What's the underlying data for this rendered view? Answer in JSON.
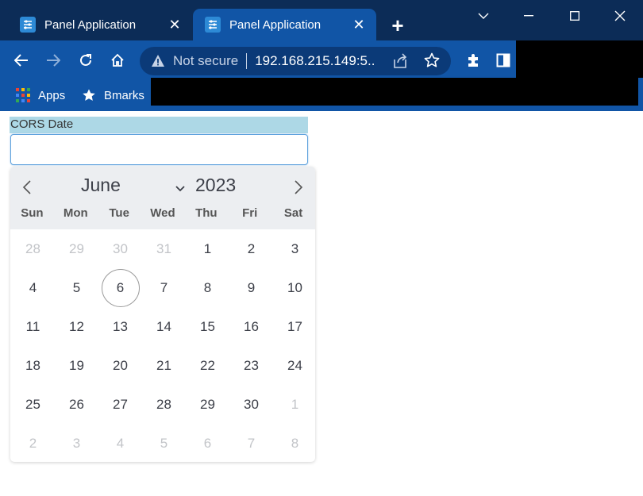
{
  "browser": {
    "tabs": [
      {
        "title": "Panel Application",
        "active": false
      },
      {
        "title": "Panel Application",
        "active": true
      }
    ],
    "omnibox": {
      "security_label": "Not secure",
      "url": "192.168.215.149:5..."
    },
    "bookmarks": [
      {
        "label": "Apps",
        "icon": "apps-grid-icon"
      },
      {
        "label": "Bmarks",
        "icon": "star-icon"
      }
    ]
  },
  "page": {
    "field_label": "CORS Date",
    "input_value": ""
  },
  "calendar": {
    "month": "June",
    "year": "2023",
    "weekdays": [
      "Sun",
      "Mon",
      "Tue",
      "Wed",
      "Thu",
      "Fri",
      "Sat"
    ],
    "weeks": [
      [
        {
          "d": "28",
          "o": true
        },
        {
          "d": "29",
          "o": true
        },
        {
          "d": "30",
          "o": true
        },
        {
          "d": "31",
          "o": true
        },
        {
          "d": "1"
        },
        {
          "d": "2"
        },
        {
          "d": "3"
        }
      ],
      [
        {
          "d": "4"
        },
        {
          "d": "5"
        },
        {
          "d": "6",
          "today": true
        },
        {
          "d": "7"
        },
        {
          "d": "8"
        },
        {
          "d": "9"
        },
        {
          "d": "10"
        }
      ],
      [
        {
          "d": "11"
        },
        {
          "d": "12"
        },
        {
          "d": "13"
        },
        {
          "d": "14"
        },
        {
          "d": "15"
        },
        {
          "d": "16"
        },
        {
          "d": "17"
        }
      ],
      [
        {
          "d": "18"
        },
        {
          "d": "19"
        },
        {
          "d": "20"
        },
        {
          "d": "21"
        },
        {
          "d": "22"
        },
        {
          "d": "23"
        },
        {
          "d": "24"
        }
      ],
      [
        {
          "d": "25"
        },
        {
          "d": "26"
        },
        {
          "d": "27"
        },
        {
          "d": "28"
        },
        {
          "d": "29"
        },
        {
          "d": "30"
        },
        {
          "d": "1",
          "o": true
        }
      ],
      [
        {
          "d": "2",
          "o": true
        },
        {
          "d": "3",
          "o": true
        },
        {
          "d": "4",
          "o": true
        },
        {
          "d": "5",
          "o": true
        },
        {
          "d": "6",
          "o": true
        },
        {
          "d": "7",
          "o": true
        },
        {
          "d": "8",
          "o": true
        }
      ]
    ]
  },
  "colors": {
    "chrome_dark": "#0c2c57",
    "chrome_accent": "#1155a6",
    "label_bg": "#add8e6",
    "calendar_header": "#eceef1"
  }
}
